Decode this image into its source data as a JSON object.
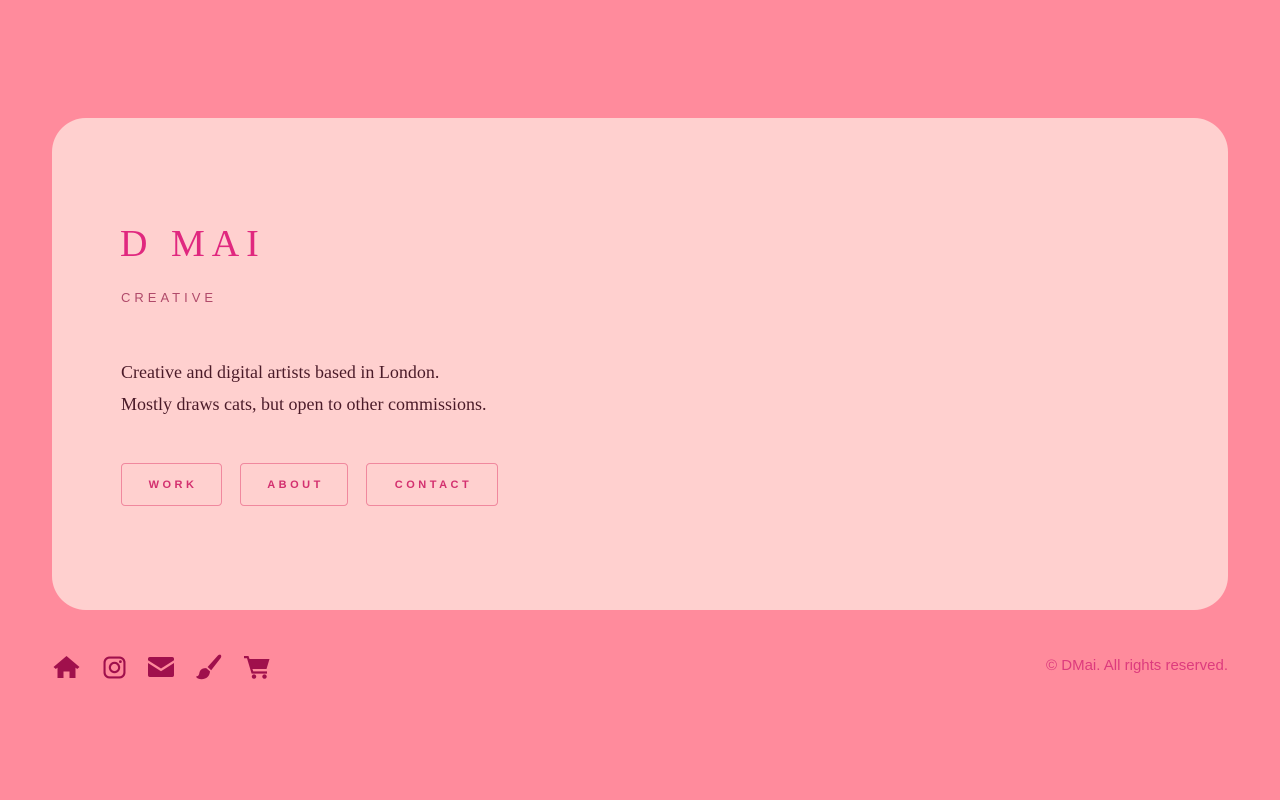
{
  "brand": {
    "title": "D MAI",
    "subtitle": "CREATIVE"
  },
  "description": {
    "line1": "Creative and digital artists based in London.",
    "line2": "Mostly draws cats, but open to other commissions."
  },
  "nav_buttons": {
    "work": "WORK",
    "about": "ABOUT",
    "contact": "CONTACT"
  },
  "social_icons": [
    "home-icon",
    "instagram-icon",
    "envelope-icon",
    "paintbrush-icon",
    "shopping-cart-icon"
  ],
  "footer": {
    "copyright": "© DMai. All rights reserved."
  },
  "colors": {
    "background": "#ff8b9c",
    "card": "#ffd0cf",
    "accent": "#e0287f",
    "icon": "#a0104c",
    "text": "#4a1a28"
  }
}
